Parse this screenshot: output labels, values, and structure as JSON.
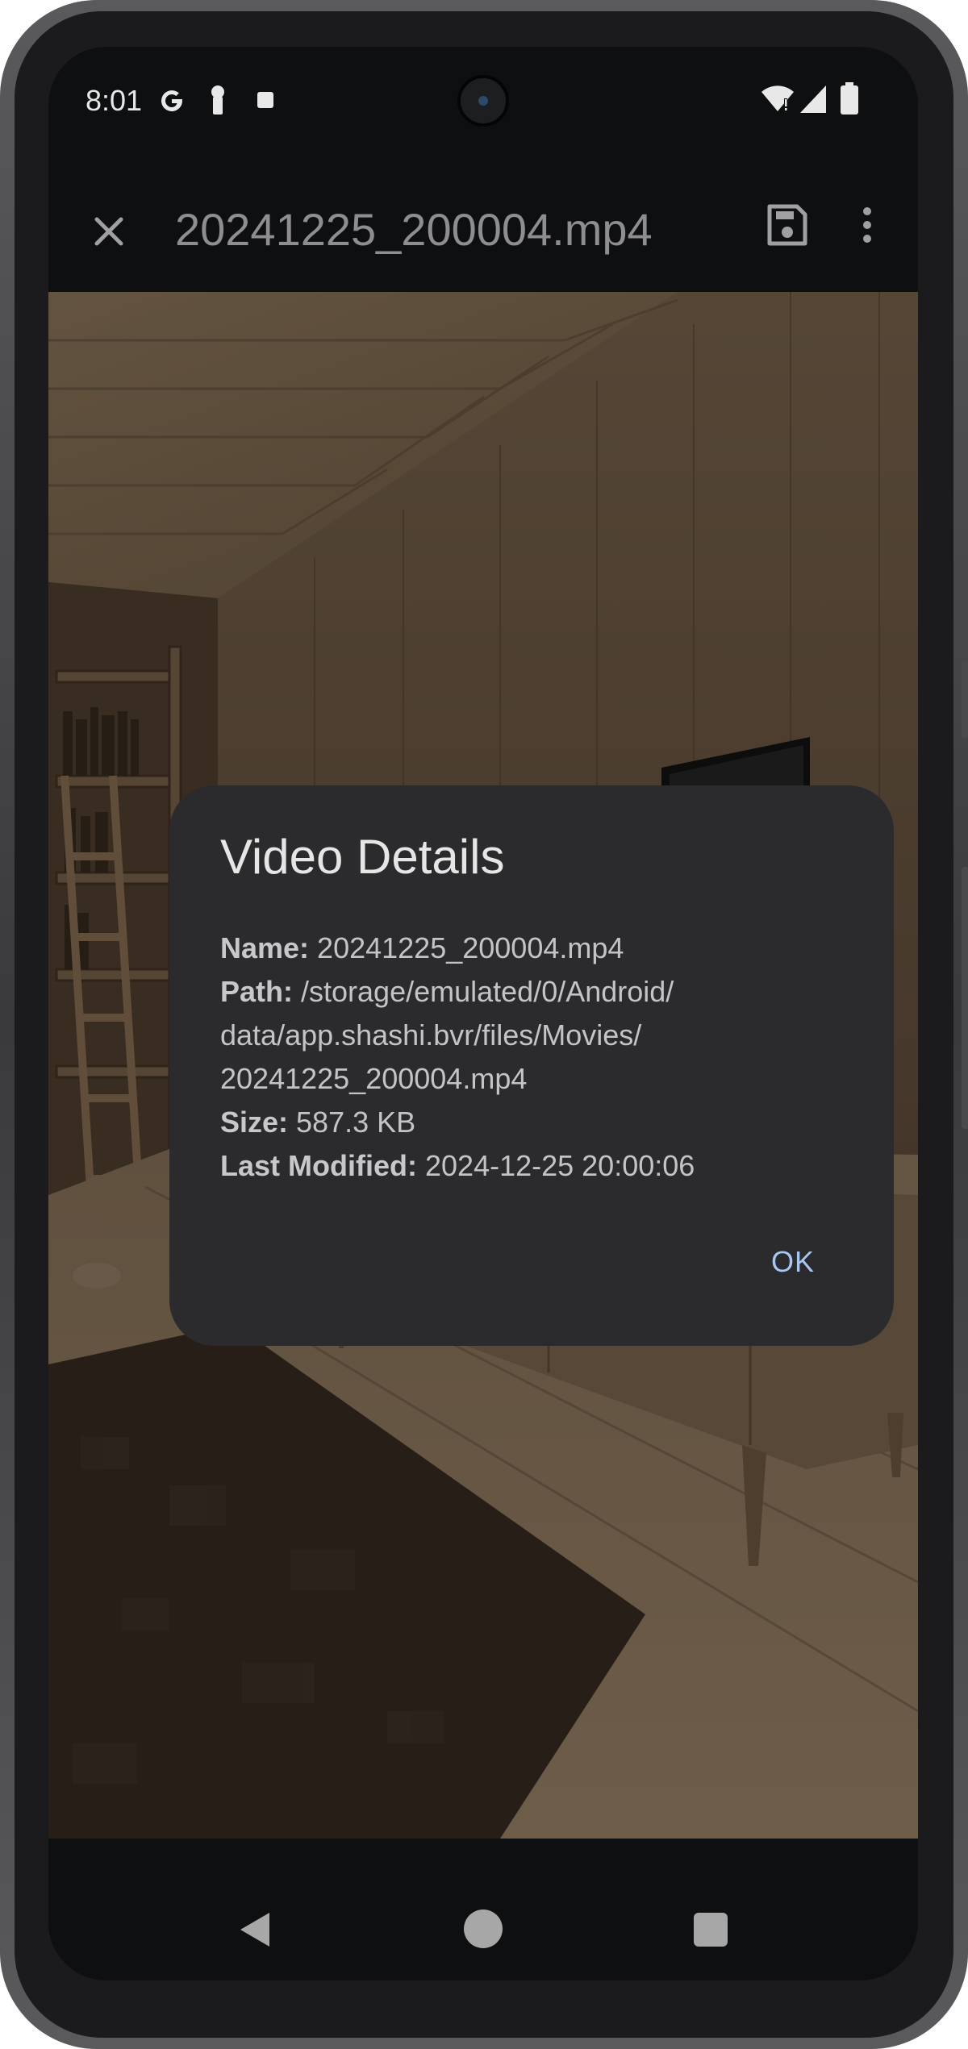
{
  "status_bar": {
    "time": "8:01"
  },
  "app_bar": {
    "title": "20241225_200004.mp4"
  },
  "dialog": {
    "title": "Video Details",
    "name_label": "Name:",
    "name_value": "20241225_200004.mp4",
    "path_label": "Path:",
    "path_line1": "/storage/emulated/0/Android/",
    "path_line2": "data/app.shashi.bvr/files/Movies/",
    "path_line3": "20241225_200004.mp4",
    "size_label": "Size:",
    "size_value": "587.3 KB",
    "modified_label": "Last Modified:",
    "modified_value": "2024-12-25 20:00:06",
    "ok_label": "OK"
  },
  "colors": {
    "dialog_bg": "#2b2b2d",
    "accent": "#a8c7f0",
    "screen_bg": "#0e0f10"
  },
  "icons": {
    "close": "close-icon",
    "save": "save-icon",
    "more": "more-vert-icon",
    "back": "nav-back-icon",
    "home": "nav-home-icon",
    "recents": "nav-recents-icon"
  }
}
